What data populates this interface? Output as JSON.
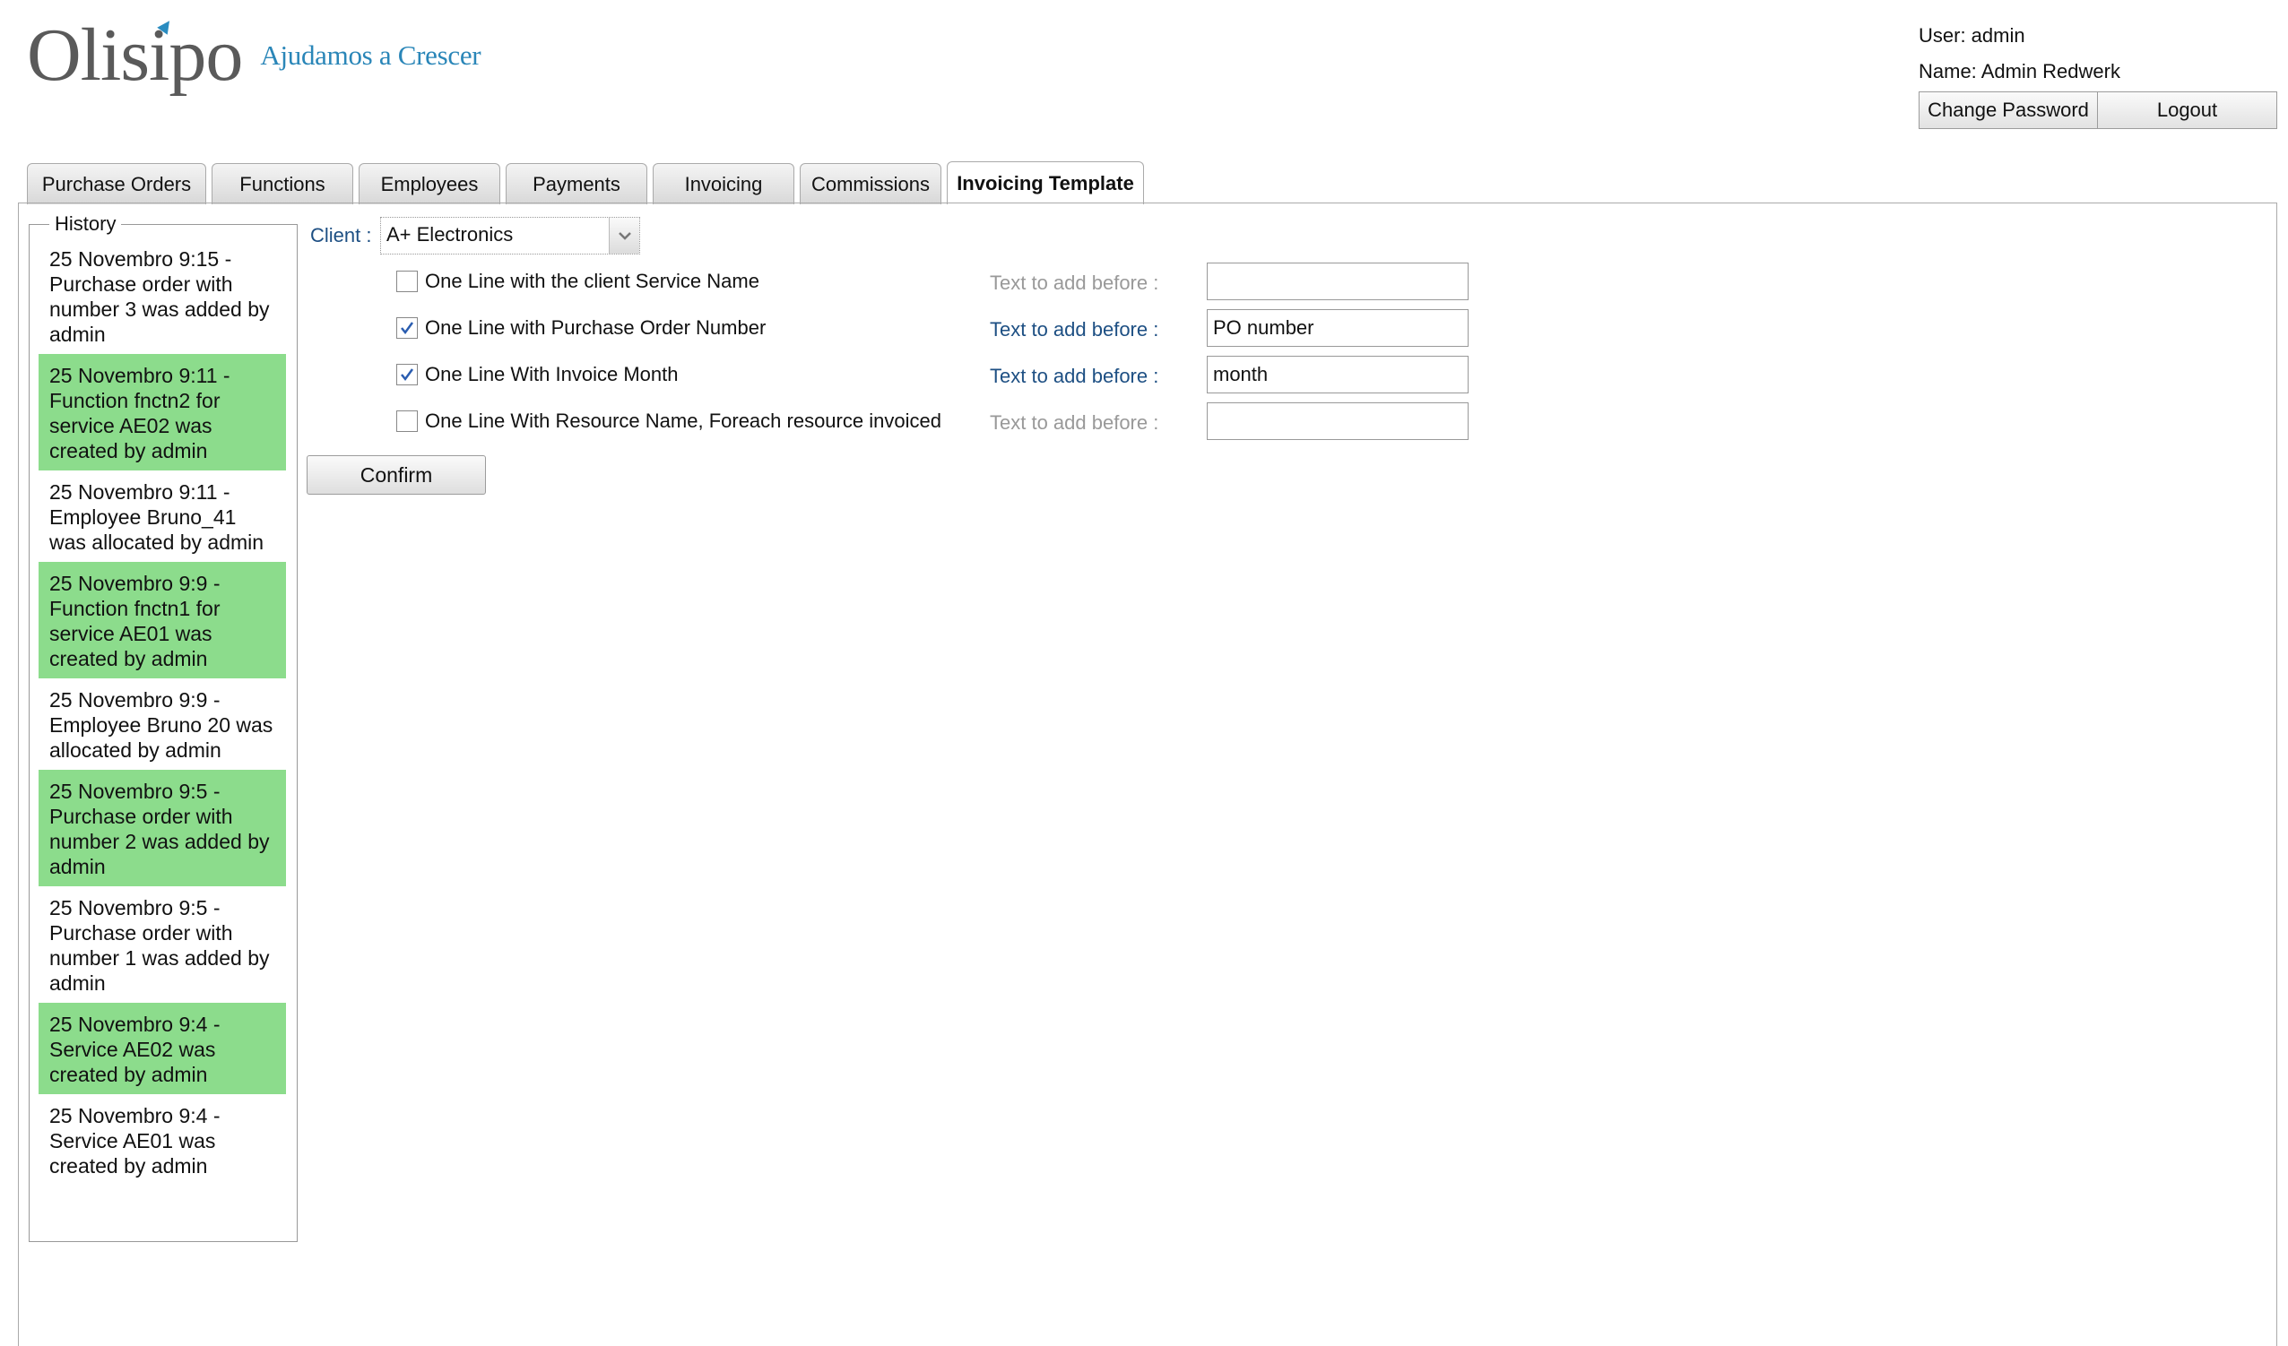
{
  "brand": {
    "name": "Olisipo",
    "tagline": "Ajudamos a Crescer"
  },
  "user": {
    "user_line": "User: admin",
    "name_line": "Name: Admin Redwerk",
    "change_password": "Change Password",
    "logout": "Logout"
  },
  "tabs": [
    {
      "label": "Purchase Orders"
    },
    {
      "label": "Functions"
    },
    {
      "label": "Employees"
    },
    {
      "label": "Payments"
    },
    {
      "label": "Invoicing"
    },
    {
      "label": "Commissions"
    },
    {
      "label": "Invoicing Template",
      "active": true
    }
  ],
  "history": {
    "legend": "History",
    "items": [
      {
        "text": "25 Novembro 9:15 - Purchase order with number 3 was added by admin",
        "highlight": false
      },
      {
        "text": "25 Novembro 9:11 - Function fnctn2 for service AE02 was created by admin",
        "highlight": true
      },
      {
        "text": "25 Novembro 9:11 - Employee Bruno_41 was allocated by admin",
        "highlight": false
      },
      {
        "text": "25 Novembro 9:9 - Function fnctn1 for service AE01 was created by admin",
        "highlight": true
      },
      {
        "text": "25 Novembro 9:9 - Employee Bruno 20 was allocated by admin",
        "highlight": false
      },
      {
        "text": "25 Novembro 9:5 - Purchase order with number 2 was added by admin",
        "highlight": true
      },
      {
        "text": "25 Novembro 9:5 - Purchase order with number 1 was added by admin",
        "highlight": false
      },
      {
        "text": "25 Novembro 9:4 - Service AE02 was created by admin",
        "highlight": true
      },
      {
        "text": "25 Novembro 9:4 - Service AE01 was created by admin",
        "highlight": false
      }
    ]
  },
  "form": {
    "client_label": "Client :",
    "client_value": "A+ Electronics",
    "options": [
      {
        "label": "One Line with the client Service Name",
        "checked": false,
        "before_label": "Text to add before :",
        "before_value": ""
      },
      {
        "label": "One Line with Purchase Order Number",
        "checked": true,
        "before_label": "Text to add before :",
        "before_value": "PO number"
      },
      {
        "label": "One Line With Invoice Month",
        "checked": true,
        "before_label": "Text to add before :",
        "before_value": "month"
      },
      {
        "label": "One Line With Resource Name, Foreach resource invoiced",
        "checked": false,
        "before_label": "Text to add before :",
        "before_value": ""
      }
    ],
    "confirm": "Confirm"
  },
  "colors": {
    "highlight": "#8cdc8c",
    "label_blue": "#1d4f83",
    "brand_blue": "#2a86b8"
  }
}
